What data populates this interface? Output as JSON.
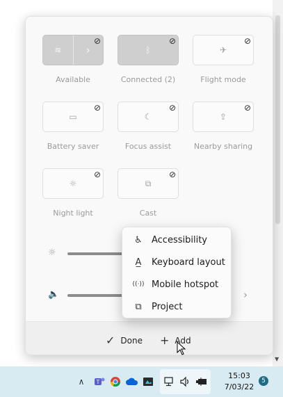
{
  "quick_settings": {
    "tiles": [
      {
        "label": "Available",
        "icon": "wifi-icon",
        "glyph": "≋",
        "active": true,
        "split": true
      },
      {
        "label": "Connected (2)",
        "icon": "bluetooth-icon",
        "glyph": "ᛒ",
        "active": true,
        "split": false
      },
      {
        "label": "Flight mode",
        "icon": "airplane-icon",
        "glyph": "✈",
        "active": false,
        "split": false
      },
      {
        "label": "Battery saver",
        "icon": "battery-saver-icon",
        "glyph": "▭",
        "active": false,
        "split": false
      },
      {
        "label": "Focus assist",
        "icon": "moon-icon",
        "glyph": "☾",
        "active": false,
        "split": false
      },
      {
        "label": "Nearby sharing",
        "icon": "share-icon",
        "glyph": "⇪",
        "active": false,
        "split": false
      },
      {
        "label": "Night light",
        "icon": "sun-icon",
        "glyph": "☼",
        "active": false,
        "split": false
      },
      {
        "label": "Cast",
        "icon": "cast-icon",
        "glyph": "⧉",
        "active": false,
        "split": false
      }
    ],
    "unpin_glyph": "⊘",
    "brightness": {
      "icon": "brightness-icon",
      "glyph": "☼"
    },
    "volume": {
      "icon": "speaker-icon",
      "glyph": "🔈",
      "chevron": "›"
    }
  },
  "footer": {
    "done": {
      "label": "Done",
      "glyph": "✓"
    },
    "add": {
      "label": "Add",
      "glyph": "+"
    }
  },
  "add_menu": {
    "items": [
      {
        "label": "Accessibility",
        "icon": "accessibility-icon",
        "glyph": "♿"
      },
      {
        "label": "Keyboard layout",
        "icon": "keyboard-layout-icon",
        "glyph": "A̲"
      },
      {
        "label": "Mobile hotspot",
        "icon": "hotspot-icon",
        "glyph": "((·))"
      },
      {
        "label": "Project",
        "icon": "project-icon",
        "glyph": "⧉"
      }
    ]
  },
  "taskbar": {
    "chevron_up": "∧",
    "clock_time": "15:03",
    "clock_date": "7/03/22",
    "notification_count": "5"
  },
  "colors": {
    "active_tile": "#cfcfcf",
    "taskbar_bg": "#d9ebf2",
    "badge": "#1e6b85"
  }
}
